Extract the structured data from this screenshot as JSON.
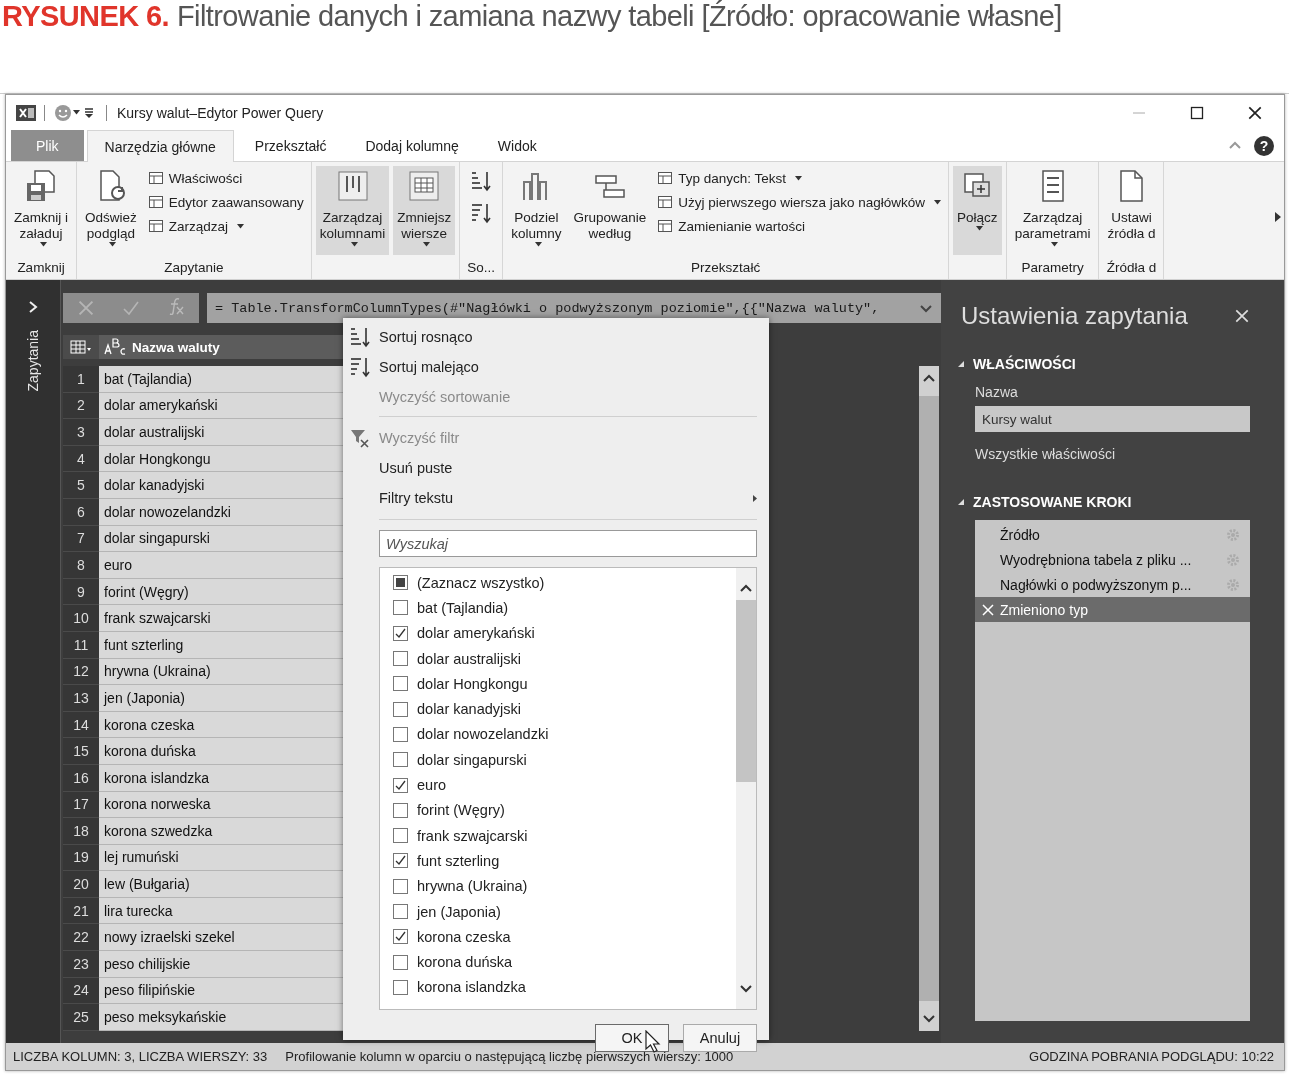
{
  "caption": {
    "label": "RYSUNEK 6.",
    "title": "Filtrowanie danych i zamiana nazwy tabeli [Źródło: opracowanie własne]"
  },
  "window": {
    "title": "Kursy walut–Edytor Power Query",
    "help": "?"
  },
  "tabs": [
    {
      "label": "Plik",
      "kind": "file",
      "selected": false
    },
    {
      "label": "Narzędzia główne",
      "kind": "tab",
      "selected": true
    },
    {
      "label": "Przekształć",
      "kind": "tab",
      "selected": false
    },
    {
      "label": "Dodaj kolumnę",
      "kind": "tab",
      "selected": false
    },
    {
      "label": "Widok",
      "kind": "tab",
      "selected": false
    }
  ],
  "ribbon": {
    "groups": [
      {
        "label": "Zamknij",
        "kind": "buttons",
        "items": [
          {
            "kind": "large",
            "label": "Zamknij i\nzaładuj",
            "dropdown": true,
            "highlighted": false
          }
        ]
      },
      {
        "label": "Zapytanie",
        "kind": "buttons",
        "items": [
          {
            "kind": "large",
            "label": "Odśwież\npodgląd",
            "dropdown": true,
            "highlighted": false
          },
          {
            "kind": "stack",
            "items": [
              {
                "label": "Właściwości",
                "dropdown": false
              },
              {
                "label": "Edytor zaawansowany",
                "dropdown": false
              },
              {
                "label": "Zarządzaj",
                "dropdown": true
              }
            ]
          }
        ]
      },
      {
        "kind": "buttons",
        "items": [
          {
            "kind": "large",
            "label": "Zarządzaj\nkolumnami",
            "dropdown": true,
            "highlighted": true
          },
          {
            "kind": "large",
            "label": "Zmniejsz\nwiersze",
            "dropdown": true,
            "highlighted": true
          }
        ]
      },
      {
        "label": "So...",
        "kind": "sort"
      },
      {
        "label": "Przekształć",
        "kind": "buttons",
        "items": [
          {
            "kind": "large",
            "label": "Podziel\nkolumny",
            "dropdown": true,
            "highlighted": false
          },
          {
            "kind": "large",
            "label": "Grupowanie\nwedług",
            "dropdown": false,
            "highlighted": false
          },
          {
            "kind": "stack",
            "items": [
              {
                "label": "Typ danych: Tekst",
                "dropdown": true
              },
              {
                "label": "Użyj pierwszego wiersza jako nagłówków",
                "dropdown": true
              },
              {
                "label": "Zamienianie wartości",
                "dropdown": false
              }
            ]
          }
        ]
      },
      {
        "kind": "buttons",
        "items": [
          {
            "kind": "large",
            "label": "Połącz",
            "dropdown": true,
            "highlighted": true
          }
        ]
      },
      {
        "label": "Parametry",
        "kind": "buttons",
        "items": [
          {
            "kind": "large",
            "label": "Zarządzaj\nparametrami",
            "dropdown": true,
            "highlighted": false
          }
        ]
      },
      {
        "label": "Źródła d",
        "kind": "buttons",
        "items": [
          {
            "kind": "large",
            "label": "Ustawi\nźródła d",
            "dropdown": false,
            "highlighted": false
          }
        ]
      }
    ]
  },
  "sidebar": {
    "label": "Zapytania"
  },
  "formula": "= Table.TransformColumnTypes(#\"Nagłówki o podwyższonym poziomie\",{{\"Nazwa waluty\",",
  "table": {
    "columns": [
      {
        "label": "Nazwa waluty"
      }
    ],
    "rows": [
      {
        "number": "1",
        "cell": "bat (Tajlandia)"
      },
      {
        "number": "2",
        "cell": "dolar amerykański"
      },
      {
        "number": "3",
        "cell": "dolar australijski"
      },
      {
        "number": "4",
        "cell": "dolar Hongkongu"
      },
      {
        "number": "5",
        "cell": "dolar kanadyjski"
      },
      {
        "number": "6",
        "cell": "dolar nowozelandzki"
      },
      {
        "number": "7",
        "cell": "dolar singapurski"
      },
      {
        "number": "8",
        "cell": "euro"
      },
      {
        "number": "9",
        "cell": "forint (Węgry)"
      },
      {
        "number": "10",
        "cell": "frank szwajcarski"
      },
      {
        "number": "11",
        "cell": "funt szterling"
      },
      {
        "number": "12",
        "cell": "hrywna (Ukraina)"
      },
      {
        "number": "13",
        "cell": "jen (Japonia)"
      },
      {
        "number": "14",
        "cell": "korona czeska"
      },
      {
        "number": "15",
        "cell": "korona duńska"
      },
      {
        "number": "16",
        "cell": "korona islandzka"
      },
      {
        "number": "17",
        "cell": "korona norweska"
      },
      {
        "number": "18",
        "cell": "korona szwedzka"
      },
      {
        "number": "19",
        "cell": "lej rumuński"
      },
      {
        "number": "20",
        "cell": "lew (Bułgaria)"
      },
      {
        "number": "21",
        "cell": "lira turecka"
      },
      {
        "number": "22",
        "cell": "nowy izraelski szekel"
      },
      {
        "number": "23",
        "cell": "peso chilijskie"
      },
      {
        "number": "24",
        "cell": "peso filipińskie"
      },
      {
        "number": "25",
        "cell": "peso meksykańskie"
      }
    ]
  },
  "filter_menu": {
    "commands": [
      {
        "kind": "sort-asc",
        "label": "Sortuj rosnąco",
        "disabled": false
      },
      {
        "kind": "sort-desc",
        "label": "Sortuj malejąco",
        "disabled": false
      },
      {
        "kind": "plain",
        "label": "Wyczyść sortowanie",
        "disabled": true
      },
      {
        "kind": "separator"
      },
      {
        "kind": "clear-filter",
        "label": "Wyczyść filtr",
        "disabled": true
      },
      {
        "kind": "plain",
        "label": "Usuń puste",
        "disabled": false
      },
      {
        "kind": "submenu",
        "label": "Filtry tekstu",
        "disabled": false
      }
    ],
    "search": {
      "placeholder": "Wyszukaj"
    },
    "select_all": {
      "label": "(Zaznacz wszystko)",
      "indeterminate": true
    },
    "values": [
      {
        "label": "bat (Tajlandia)",
        "checked": false
      },
      {
        "label": "dolar amerykański",
        "checked": true
      },
      {
        "label": "dolar australijski",
        "checked": false
      },
      {
        "label": "dolar Hongkongu",
        "checked": false
      },
      {
        "label": "dolar kanadyjski",
        "checked": false
      },
      {
        "label": "dolar nowozelandzki",
        "checked": false
      },
      {
        "label": "dolar singapurski",
        "checked": false
      },
      {
        "label": "euro",
        "checked": true
      },
      {
        "label": "forint (Węgry)",
        "checked": false
      },
      {
        "label": "frank szwajcarski",
        "checked": false
      },
      {
        "label": "funt szterling",
        "checked": true
      },
      {
        "label": "hrywna (Ukraina)",
        "checked": false
      },
      {
        "label": "jen (Japonia)",
        "checked": false
      },
      {
        "label": "korona czeska",
        "checked": true
      },
      {
        "label": "korona duńska",
        "checked": false
      },
      {
        "label": "korona islandzka",
        "checked": false
      }
    ],
    "buttons": [
      {
        "label": "OK",
        "kind": "primary"
      },
      {
        "label": "Anuluj",
        "kind": "cancel"
      }
    ]
  },
  "settings": {
    "title": "Ustawienia zapytania",
    "properties_heading": "WŁAŚCIWOŚCI",
    "name_label": "Nazwa",
    "name_value": "Kursy walut",
    "all_properties": "Wszystkie właściwości",
    "steps_heading": "ZASTOSOWANE KROKI",
    "steps": [
      {
        "label": "Źródło",
        "selected": false
      },
      {
        "label": "Wyodrębniona tabela z pliku ...",
        "selected": false
      },
      {
        "label": "Nagłówki o podwyższonym p...",
        "selected": false
      },
      {
        "label": "Zmieniono typ",
        "selected": true
      }
    ]
  },
  "status_bar": {
    "left": "LICZBA KOLUMN: 3, LICZBA WIERSZY: 33",
    "middle": "Profilowanie kolumn w oparciu o następującą liczbę pierwszych wierszy: 1000",
    "right": "GODZINA POBRANIA PODGLĄDU: 10:22"
  }
}
